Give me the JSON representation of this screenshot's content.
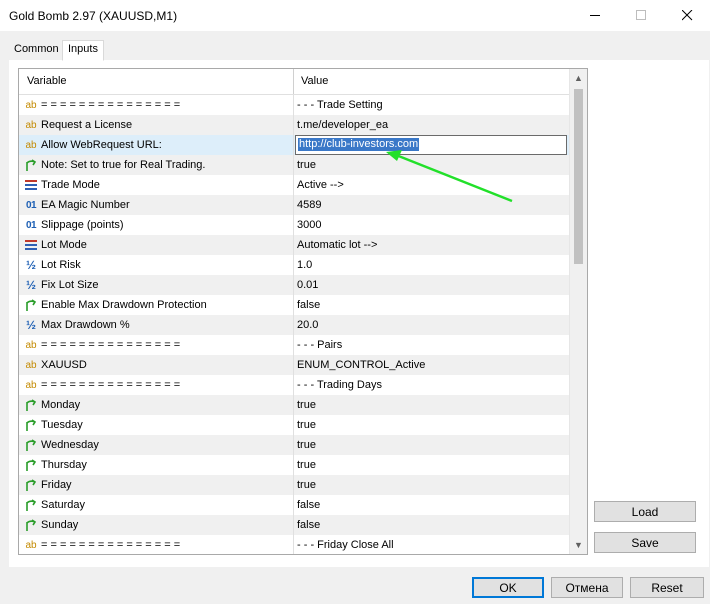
{
  "window": {
    "title": "Gold Bomb 2.97 (XAUUSD,M1)",
    "minimize_label": "—",
    "maximize_label": "☐",
    "close_label": "✕"
  },
  "tabs": [
    {
      "label": "Common",
      "active": false
    },
    {
      "label": "Inputs",
      "active": true
    }
  ],
  "table": {
    "headers": {
      "variable": "Variable",
      "value": "Value"
    },
    "rows": [
      {
        "icon": "ab-icon",
        "name": "= = = = = = = = = = = = = = =",
        "value": "- - - Trade Setting"
      },
      {
        "icon": "ab-icon",
        "name": "Request a License",
        "value": "t.me/developer_ea"
      },
      {
        "icon": "ab-icon",
        "name": "Allow WebRequest URL:",
        "value": "http://club-investors.com",
        "editing": true
      },
      {
        "icon": "bool-icon",
        "name": "Note: Set to true for Real Trading.",
        "value": "true"
      },
      {
        "icon": "enum-icon",
        "name": "Trade Mode",
        "value": "Active -->"
      },
      {
        "icon": "int-icon",
        "name": "EA Magic Number",
        "value": "4589"
      },
      {
        "icon": "int-icon",
        "name": "Slippage (points)",
        "value": "3000"
      },
      {
        "icon": "enum-icon",
        "name": "Lot Mode",
        "value": "Automatic lot -->"
      },
      {
        "icon": "double-icon",
        "name": "Lot Risk",
        "value": "1.0"
      },
      {
        "icon": "double-icon",
        "name": "Fix Lot Size",
        "value": "0.01"
      },
      {
        "icon": "bool-icon",
        "name": "Enable Max Drawdown Protection",
        "value": "false"
      },
      {
        "icon": "double-icon",
        "name": "Max Drawdown %",
        "value": "20.0"
      },
      {
        "icon": "ab-icon",
        "name": "= = = = = = = = = = = = = = =",
        "value": "- - - Pairs"
      },
      {
        "icon": "ab-icon",
        "name": "XAUUSD",
        "value": "ENUM_CONTROL_Active"
      },
      {
        "icon": "ab-icon",
        "name": "= = = = = = = = = = = = = = =",
        "value": "- - - Trading Days"
      },
      {
        "icon": "bool-icon",
        "name": "Monday",
        "value": "true"
      },
      {
        "icon": "bool-icon",
        "name": "Tuesday",
        "value": "true"
      },
      {
        "icon": "bool-icon",
        "name": "Wednesday",
        "value": "true"
      },
      {
        "icon": "bool-icon",
        "name": "Thursday",
        "value": "true"
      },
      {
        "icon": "bool-icon",
        "name": "Friday",
        "value": "true"
      },
      {
        "icon": "bool-icon",
        "name": "Saturday",
        "value": "false"
      },
      {
        "icon": "bool-icon",
        "name": "Sunday",
        "value": "false"
      },
      {
        "icon": "ab-icon",
        "name": "= = = = = = = = = = = = = = =",
        "value": "- - - Friday Close All"
      }
    ]
  },
  "buttons": {
    "load": "Load",
    "save": "Save",
    "ok": "OK",
    "cancel": "Отмена",
    "reset": "Reset"
  },
  "colors": {
    "annotation_arrow": "#22e02a",
    "selection": "#3a78c8"
  }
}
